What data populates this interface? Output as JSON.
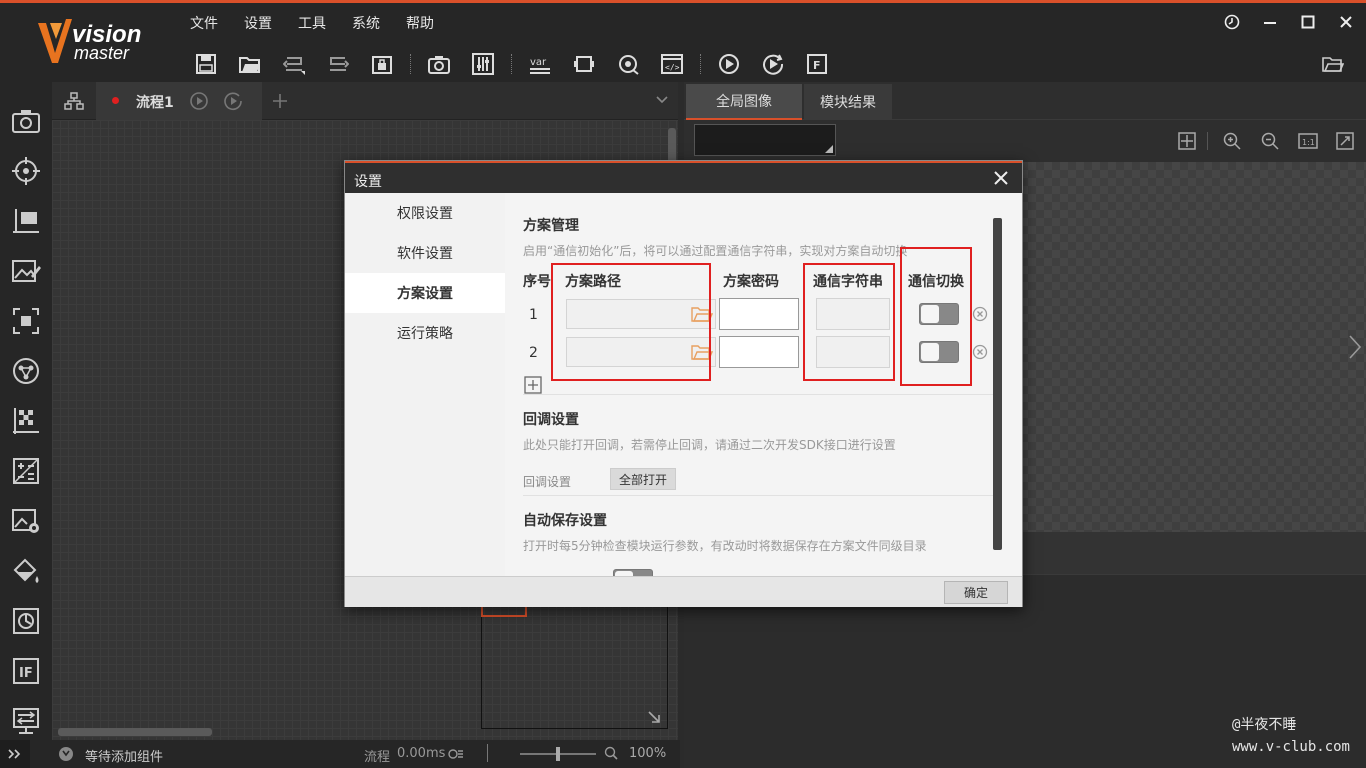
{
  "app": {
    "logo_text_1": "vision",
    "logo_text_2": "master"
  },
  "menu": [
    "文件",
    "设置",
    "工具",
    "系统",
    "帮助"
  ],
  "toolbar_icons": [
    "save-icon",
    "open-folder-icon",
    "undo-icon",
    "redo-icon",
    "lock-icon",
    "camera-icon",
    "controller-icon",
    "variable-icon",
    "device-icon",
    "rotate-icon",
    "code-icon",
    "run-once-icon",
    "run-loop-icon",
    "font-icon"
  ],
  "flow": {
    "tab_label": "流程1"
  },
  "right_panel": {
    "tab_global_image": "全局图像",
    "tab_module_result": "模块结果"
  },
  "status": {
    "waiting_text": "等待添加组件",
    "flow_label": "流程",
    "flow_time": "0.00ms",
    "zoom": "100%"
  },
  "watermark": {
    "line1": "@半夜不睡",
    "line2": "www.v-club.com"
  },
  "dialog": {
    "title": "设置",
    "sidebar": [
      "权限设置",
      "软件设置",
      "方案设置",
      "运行策略"
    ],
    "active_sidebar": "方案设置",
    "ok_label": "确定",
    "solution_mgmt": {
      "title": "方案管理",
      "desc": "启用“通信初始化”后，将可以通过配置通信字符串，实现对方案自动切换",
      "col_no": "序号",
      "col_path": "方案路径",
      "col_pwd": "方案密码",
      "col_comm": "通信字符串",
      "col_switch": "通信切换",
      "rows": [
        {
          "no": "1",
          "path": "",
          "password": "",
          "comm": "",
          "switch_on": false
        },
        {
          "no": "2",
          "path": "",
          "password": "",
          "comm": "",
          "switch_on": false
        }
      ]
    },
    "callback": {
      "title": "回调设置",
      "desc": "此处只能打开回调，若需停止回调，请通过二次开发SDK接口进行设置",
      "label": "回调设置",
      "button": "全部打开"
    },
    "autosave": {
      "title": "自动保存设置",
      "desc": "打开时每5分钟检查模块运行参数，有改动时将数据保存在方案文件同级目录"
    }
  },
  "colors": {
    "accent": "#d9502a",
    "highlight_box": "#e02020"
  }
}
